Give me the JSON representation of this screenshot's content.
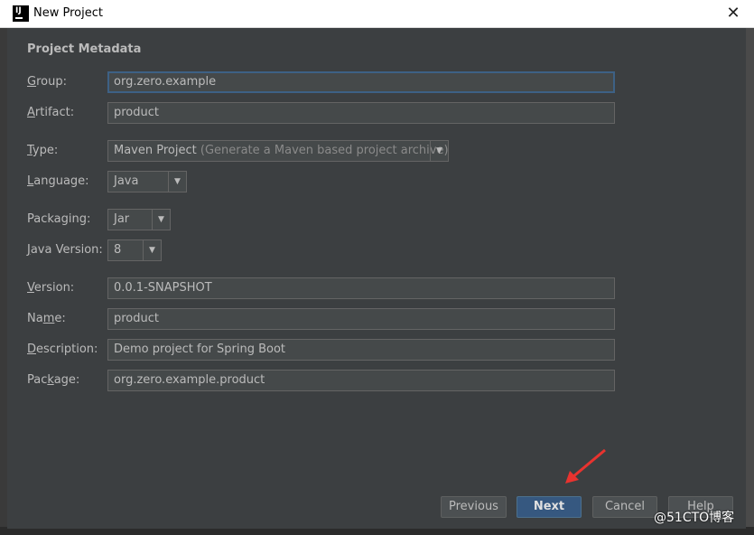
{
  "window": {
    "title": "New Project",
    "app_icon": "intellij-icon"
  },
  "form": {
    "section_title": "Project Metadata",
    "group": {
      "label": "Group:",
      "mnemonic": "G",
      "rest": "roup:",
      "value": "org.zero.example"
    },
    "artifact": {
      "label": "Artifact:",
      "mnemonic": "A",
      "rest": "rtifact:",
      "value": "product"
    },
    "type": {
      "label": "Type:",
      "mnemonic": "T",
      "rest": "ype:",
      "value": "Maven Project",
      "hint": " (Generate a Maven based project archive)"
    },
    "language": {
      "label": "Language:",
      "pre": "",
      "mnemonic": "L",
      "rest": "anguage:",
      "value": "Java"
    },
    "packaging": {
      "label": "Packaging:",
      "value": "Jar"
    },
    "java_version": {
      "label": "Java Version:",
      "mnemonic": "J",
      "rest": "ava Version:",
      "value": "8"
    },
    "version": {
      "label": "Version:",
      "mnemonic": "V",
      "rest": "ersion:",
      "value": "0.0.1-SNAPSHOT"
    },
    "name": {
      "label": "Name:",
      "pre": "Na",
      "mnemonic": "m",
      "rest": "e:",
      "value": "product"
    },
    "description": {
      "label": "Description:",
      "mnemonic": "D",
      "rest": "escription:",
      "value": "Demo project for Spring Boot"
    },
    "package": {
      "label": "Package:",
      "pre": "Pac",
      "mnemonic": "k",
      "rest": "age:",
      "value": "org.zero.example.product"
    }
  },
  "buttons": {
    "previous": "Previous",
    "next": "Next",
    "cancel": "Cancel",
    "help": "Help"
  },
  "watermark": "@51CTO博客",
  "colors": {
    "accent": "#365880",
    "focus_border": "#3d6185",
    "annotation_arrow": "#e8332f"
  }
}
